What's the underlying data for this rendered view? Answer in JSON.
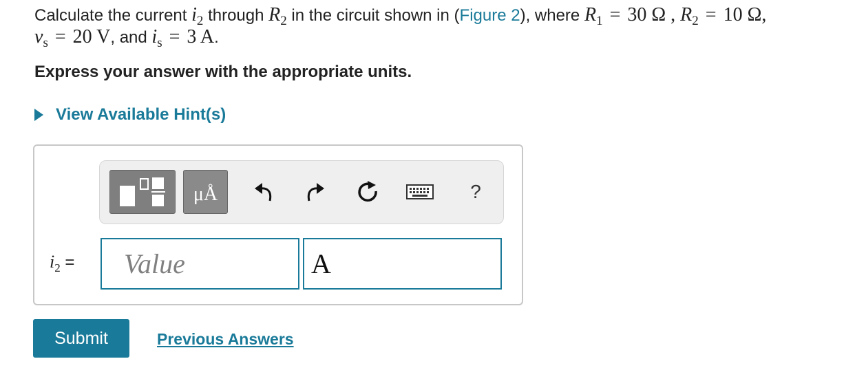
{
  "question": {
    "intro": "Calculate the current ",
    "var_i": "i",
    "var_i_sub": "2",
    "through_text": " through ",
    "var_R": "R",
    "var_R_sub": "2",
    "shown_text": " in the circuit shown in (",
    "figure_link": "Figure 2",
    "where_text": "), where ",
    "r1_var": "R",
    "r1_sub": "1",
    "eq": "=",
    "r1_value": "30 Ω ,",
    "r2_var": "R",
    "r2_sub": "2",
    "r2_value": "10 Ω,",
    "vs_var": "v",
    "vs_sub": "s",
    "vs_value": "20 V",
    "and_text": ", and ",
    "is_var": "i",
    "is_sub": "s",
    "is_value": "3 A",
    "period": "."
  },
  "instruction": "Express your answer with the appropriate units.",
  "hint": {
    "label": "View Available Hint(s)"
  },
  "toolbar": {
    "units_label": "μÅ",
    "help_label": "?"
  },
  "answer": {
    "label_var": "i",
    "label_sub": "2",
    "label_eq": "=",
    "value_placeholder": "Value",
    "unit_value": "A"
  },
  "actions": {
    "submit_label": "Submit",
    "previous_answers_label": "Previous Answers"
  },
  "colors": {
    "accent": "#1a7a99",
    "toolbar_bg": "#efefef",
    "box_border": "#c7c7c7"
  }
}
